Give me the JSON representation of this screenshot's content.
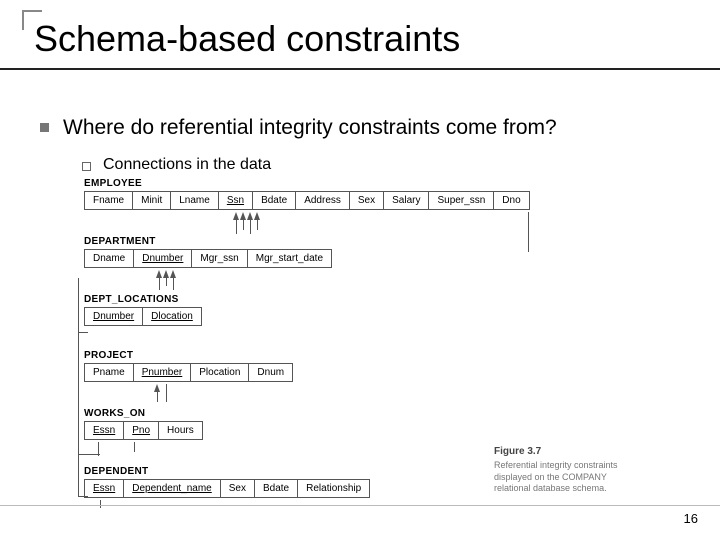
{
  "title": "Schema-based constraints",
  "bullet1": "Where do referential integrity constraints come from?",
  "bullet2": "Connections in the data",
  "tables": {
    "employee": {
      "name": "EMPLOYEE",
      "cols": [
        "Fname",
        "Minit",
        "Lname",
        "Ssn",
        "Bdate",
        "Address",
        "Sex",
        "Salary",
        "Super_ssn",
        "Dno"
      ]
    },
    "department": {
      "name": "DEPARTMENT",
      "cols": [
        "Dname",
        "Dnumber",
        "Mgr_ssn",
        "Mgr_start_date"
      ]
    },
    "dept_locations": {
      "name": "DEPT_LOCATIONS",
      "cols": [
        "Dnumber",
        "Dlocation"
      ]
    },
    "project": {
      "name": "PROJECT",
      "cols": [
        "Pname",
        "Pnumber",
        "Plocation",
        "Dnum"
      ]
    },
    "works_on": {
      "name": "WORKS_ON",
      "cols": [
        "Essn",
        "Pno",
        "Hours"
      ]
    },
    "dependent": {
      "name": "DEPENDENT",
      "cols": [
        "Essn",
        "Dependent_name",
        "Sex",
        "Bdate",
        "Relationship"
      ]
    }
  },
  "caption": {
    "title": "Figure 3.7",
    "body": "Referential integrity constraints displayed on the COMPANY relational database schema."
  },
  "page": "16"
}
